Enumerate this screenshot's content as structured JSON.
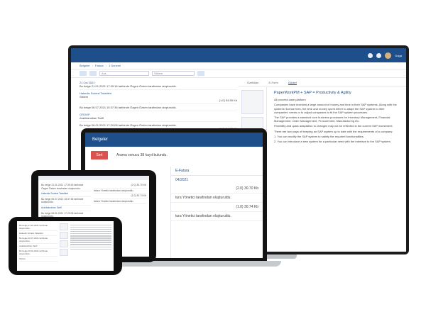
{
  "monitor": {
    "header": {
      "user_name": "Doga"
    },
    "breadcrumbs": [
      "Belgeler",
      "Fatura",
      "1 Donemi"
    ],
    "toolbar": {
      "search_placeholder": "Ara...",
      "filter_value": "Sistem"
    },
    "list": [
      {
        "date": "21 Ocl 2021",
        "text": "Bu belge 21.01.2021 17:39:18 tarihinde Özgen Özden tarafından oluşturuldu.",
        "size": "(1.0) 54.55 Kb"
      },
      {
        "link": "Hakedis Sozlesi Taksitleri",
        "text": "Sistem",
        "size": "(1.0) 54.55 Kb"
      },
      {
        "text": "Bu belge 06.07.2021 15:37:36 tarihinde Özgen Özden tarafından oluşturuldu.",
        "size": ""
      },
      {
        "link": "GROUP",
        "text": "Aralıklandiran Tarifi",
        "size": ""
      },
      {
        "text": "Bu belge 06.01.2021 17:20:08 tarihinde Özgen Özden tarafından oluşturuldu.",
        "size": "(1.0) 54.55 Kb"
      }
    ],
    "tabs": [
      "Özellikler",
      "E-Form",
      "Görsel"
    ],
    "doc": {
      "title": "PaperWorkPM + SAP = Productivity & Agility",
      "paragraphs": [
        "All process case platform",
        "Companies have invested a large amount of money and time in their SAP systems. Along with the systems' license fees, the time and money spent either to adapt the SAP system to their companies' needs or to adjust companies to fit the SAP system processes.",
        "The SAP provides a standard core business processes for Inventory Management, Financial Management, Order Management, Procurement, Manufacturing etc.",
        "Flexibility and quick adaptation to changes may not be reflected in the current SAP investment.",
        "There are two ways of keeping an SAP system up to date with the requirements of a company:",
        "1. You can modify the SAP system to satisfy the required functionalities.",
        "2. You can introduce a new system for a particular need with the interface to the SAP system."
      ]
    }
  },
  "laptop": {
    "header_crumb": "Belgeler",
    "result_text": "Arama sonucu 38 kayıt bulundu.",
    "button_label": "Sert",
    "tab_label": "E-Fatura",
    "date": "04/2021",
    "rows": [
      {
        "text": "",
        "size": "(2.0) 30.70 Kb"
      },
      {
        "text": "tura Yönetici tarafından oluşturuldu.",
        "size": ""
      },
      {
        "text": "",
        "size": "(1.0) 30.74 Kb"
      },
      {
        "text": "tura Yönetici tarafından oluşturuldu.",
        "size": ""
      }
    ]
  },
  "tablet": {
    "left_items": [
      "Bu belge 21.01.2021 17:39:18 tarihinde Özgen Özden tarafından oluşturuldu.",
      "Hakedis Sozlesi Taksitleri",
      "Bu belge 06.07.2021 15:37:36 tarihinde oluşturuldu.",
      "Aralıklandiran Tarifi",
      "Bu belge 06.01.2021 17:20:08 tarihinde oluşturuldu."
    ],
    "right_items": [
      {
        "text": "(2.0) 30.70 Kb"
      },
      {
        "text": "fatura Yönetici tarafından oluşturuldu."
      },
      {
        "text": "(1.0) 30.74 Kb"
      },
      {
        "text": "fatura Yönetici tarafından oluşturuldu."
      }
    ]
  },
  "phone": {
    "items": [
      "Bu belge 21.01.2021 tarihinde oluşturuldu.",
      "Hakedis Sozlesi Taksitleri",
      "Bu belge 06.07.2021 tarihinde oluşturuldu.",
      "Aralıklandiran Tarifi",
      "Bu belge 06.01.2021 tarihinde oluşturuldu.",
      "Sistem"
    ]
  }
}
